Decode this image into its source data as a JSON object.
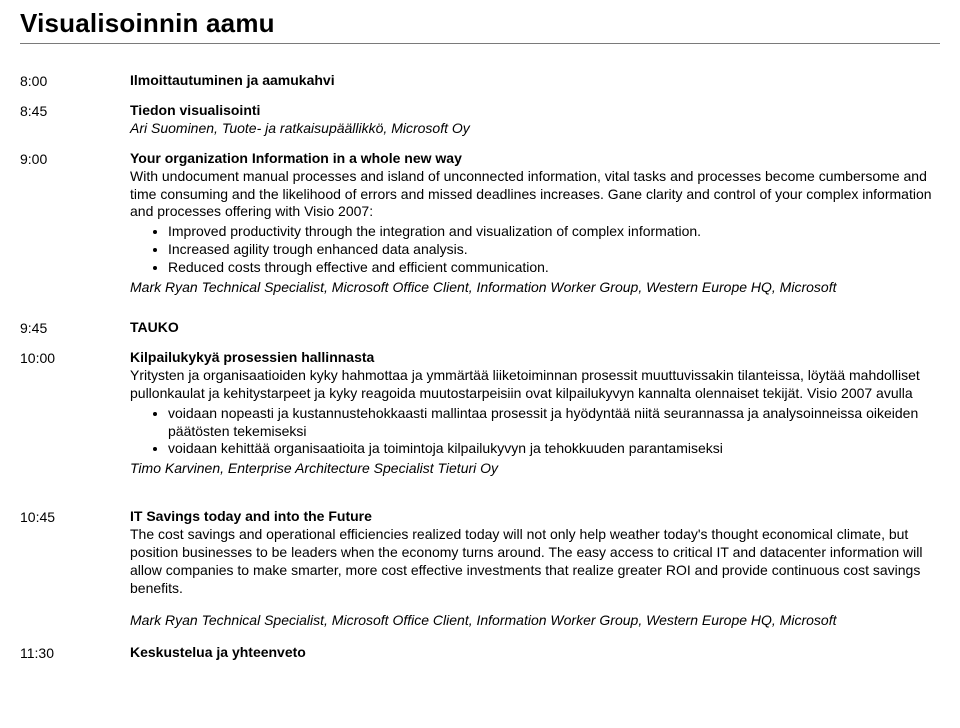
{
  "title": "Visualisoinnin aamu",
  "slots": {
    "s1": {
      "time": "8:00",
      "heading": "Ilmoittautuminen ja aamukahvi"
    },
    "s2": {
      "time": "8:45",
      "heading": "Tiedon visualisointi",
      "speaker": "Ari Suominen, Tuote- ja ratkaisupäällikkö, Microsoft Oy"
    },
    "s3": {
      "time": "9:00",
      "heading": "Your organization Information in a whole new way",
      "lead": "With undocument manual processes and island of unconnected information, vital tasks and processes become cumbersome and time consuming and the likelihood of errors and missed deadlines increases. Gane clarity and control of your complex information and processes offering with Visio 2007:",
      "bullets": [
        "Improved productivity through the integration and visualization of complex information.",
        "Increased agility trough enhanced data analysis.",
        "Reduced costs through effective and efficient communication."
      ],
      "speaker": "Mark Ryan Technical Specialist, Microsoft Office Client, Information Worker Group, Western Europe HQ, Microsoft"
    },
    "s4": {
      "time": "9:45",
      "heading": "TAUKO"
    },
    "s5": {
      "time": "10:00",
      "heading": "Kilpailukykyä prosessien hallinnasta",
      "lead": "Yritysten ja organisaatioiden kyky hahmottaa ja ymmärtää liiketoiminnan prosessit muuttuvissakin tilanteissa, löytää mahdolliset pullonkaulat ja kehitystarpeet ja kyky reagoida muutostarpeisiin ovat kilpailukyvyn kannalta olennaiset tekijät. Visio 2007 avulla",
      "bullets": [
        "voidaan nopeasti ja kustannustehokkaasti mallintaa prosessit ja hyödyntää niitä seurannassa ja analysoinneissa oikeiden päätösten tekemiseksi",
        "voidaan kehittää organisaatioita ja toimintoja kilpailukyvyn ja tehokkuuden parantamiseksi"
      ],
      "speaker": "Timo Karvinen, Enterprise Architecture Specialist Tieturi Oy"
    },
    "s6": {
      "time": "10:45",
      "heading": "IT Savings today and into the Future",
      "lead": "The cost savings and operational efficiencies realized today will not only help weather today's thought economical climate, but position businesses to be leaders when the economy turns around. The easy access to critical IT and datacenter information will allow companies to make smarter, more cost effective investments that realize greater ROI and provide continuous cost savings benefits.",
      "speaker": "Mark Ryan Technical Specialist, Microsoft Office Client, Information Worker Group, Western Europe HQ, Microsoft"
    },
    "s7": {
      "time": "11:30",
      "heading": "Keskustelua ja yhteenveto"
    }
  }
}
